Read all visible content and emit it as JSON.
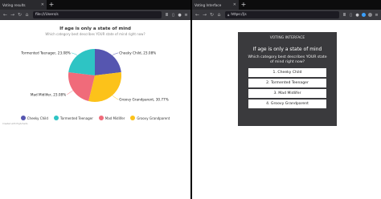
{
  "left_window": {
    "tab_title": "Voting results",
    "url": "file:///Users/s",
    "chart_data": {
      "type": "pie",
      "title": "If age is only a state of mind",
      "subtitle": "Which category best describes YOUR state of mind right now?",
      "categories": [
        "Cheeky Child",
        "Tormented Teenager",
        "Mad Midlifer",
        "Groovy Grandparent"
      ],
      "values": [
        23.08,
        23.08,
        23.08,
        30.77
      ],
      "slice_labels": [
        "Cheeky Child, 23.08%",
        "Tormented Teenager, 23.08%",
        "Mad Midlifer, 23.08%",
        "Groovy Grandparent, 30.77%"
      ],
      "colors": [
        "#5656b0",
        "#2ec4c4",
        "#f06b7a",
        "#fcc21a"
      ],
      "legend_position": "bottom"
    },
    "credit": "Created with Highcharts"
  },
  "right_window": {
    "tab_title": "Voting Interface",
    "url": "https://js",
    "header": "VOTING INTERFACE",
    "title": "If age is only a state of mind",
    "question": "Which category best describes YOUR state of mind right now?",
    "options": [
      "1. Cheeky Child",
      "2. Tormented Teenager",
      "3. Mad Midlifer",
      "4. Groovy Grandparent"
    ],
    "card_color": "#3a3a3d"
  },
  "icons": {
    "back": "back-arrow-icon",
    "forward": "forward-arrow-icon",
    "reload": "reload-icon",
    "home": "home-icon",
    "close": "close-icon",
    "new_tab": "plus-icon",
    "menu": "hamburger-icon"
  }
}
